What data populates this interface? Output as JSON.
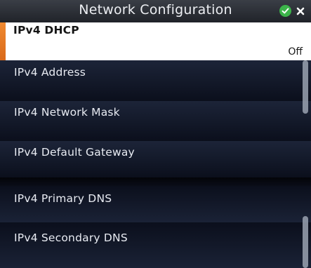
{
  "title": "Network Configuration",
  "icons": {
    "ok": "checkmark-icon",
    "close": "close-icon",
    "ok_color": "#3cb44a",
    "accent_color": "#f08a30"
  },
  "items": [
    {
      "label": "IPv4 DHCP",
      "value": "Off"
    },
    {
      "label": "IPv4 Address"
    },
    {
      "label": "IPv4 Network Mask"
    },
    {
      "label": "IPv4 Default Gateway"
    },
    {
      "label": "IPv4 Primary DNS"
    },
    {
      "label": "IPv4 Secondary DNS"
    }
  ]
}
